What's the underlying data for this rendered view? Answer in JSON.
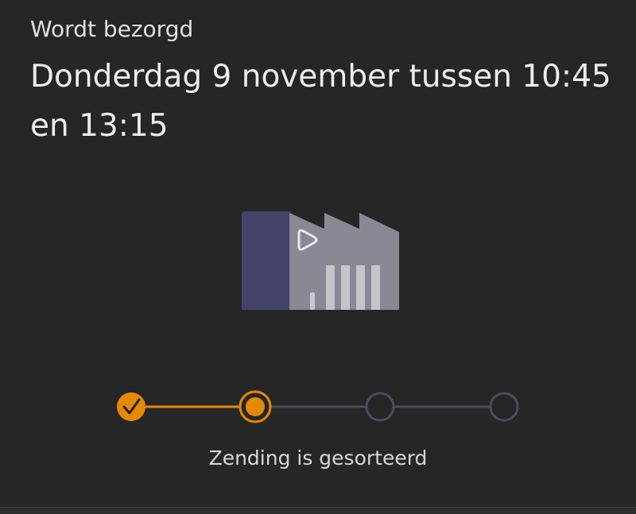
{
  "header": {
    "status_label": "Wordt bezorgd",
    "delivery_window": "Donderdag 9 november tussen 10:45 en 13:15"
  },
  "illustration": {
    "icon": "sorting-center-factory-icon"
  },
  "progress": {
    "steps_total": 4,
    "current_step": 2,
    "completed_steps": 1,
    "caption": "Zending is gesorteerd",
    "colors": {
      "active": "#e58a00",
      "inactive": "#4a4d5a",
      "check": "#1f1f1f"
    }
  }
}
